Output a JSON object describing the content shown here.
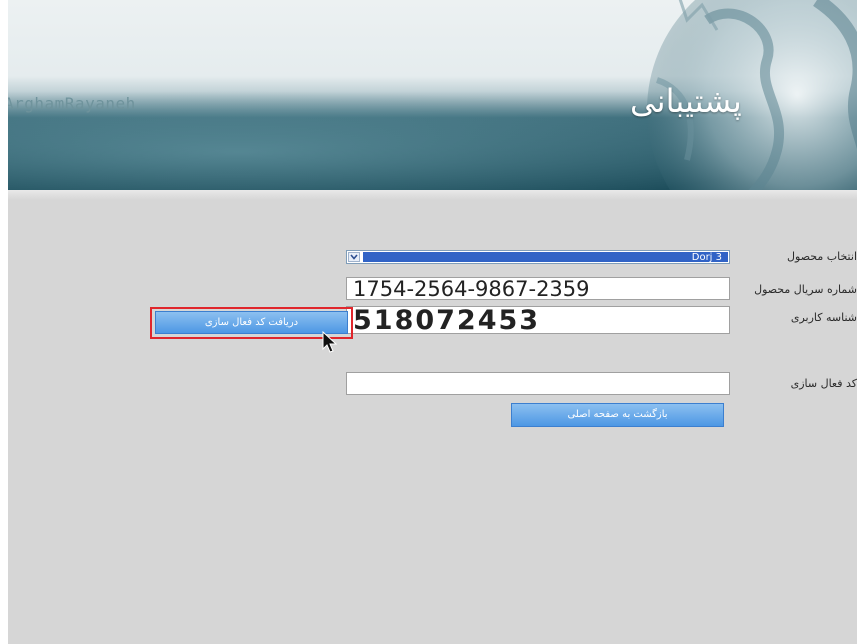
{
  "banner": {
    "brand_text": "ArghamRayaneh",
    "title": "پشتیبانی"
  },
  "form": {
    "product_label": "انتخاب محصول",
    "product_selected": "Dorj 3",
    "serial_label": "شماره سریال محصول",
    "serial_value": "1754-2564-9867-2359",
    "user_id_label": "شناسه کاربری",
    "user_id_value": "518072453",
    "get_code_button": "دریافت کد فعال سازی",
    "activation_label": "کد فعال سازی",
    "activation_value": "",
    "back_button": "بازگشت به صفحه اصلی"
  },
  "icons": {
    "dropdown": "chevron-down-icon",
    "cursor": "mouse-pointer-icon"
  },
  "colors": {
    "banner_dark": "#1e4e5c",
    "page_bg": "#d6d6d6",
    "button_blue": "#4d97e4",
    "highlight_red": "#e0262c",
    "select_highlight": "#3163c6"
  }
}
